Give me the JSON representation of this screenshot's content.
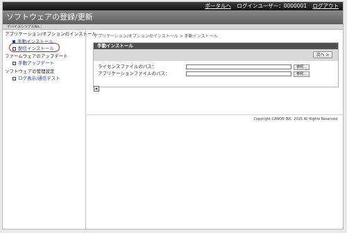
{
  "topbar": {
    "portal_link": "ポータルへ",
    "login_user_label": "ログインユーザー：",
    "login_user_id": "0000001",
    "logout_link": "ログアウト"
  },
  "header": {
    "title": "ソフトウェアの登録/更新"
  },
  "subheader": {
    "device_serial": "デバイスシリアルNo.："
  },
  "sidebar": {
    "sections": [
      {
        "label": "アプリケーション/オプションのインストール",
        "items": [
          {
            "label": "手動インストール",
            "selected": true
          },
          {
            "label": "配信インストール",
            "selected": false
          }
        ]
      },
      {
        "label": "ファームウェアのアップデート",
        "items": [
          {
            "label": "手動アップデート",
            "selected": false
          }
        ]
      },
      {
        "label": "ソフトウェアの管理設定",
        "items": [
          {
            "label": "ログ表示/通信テスト",
            "selected": false
          }
        ]
      }
    ]
  },
  "breadcrumb": "アプリケーション/オプションのインストール > 手動インストール",
  "panel": {
    "title": "手動インストール",
    "next_button": "次へ >",
    "license_label": "ライセンスファイルのパス：",
    "license_value": "",
    "application_label": "アプリケーションファイルのパス：",
    "application_value": "",
    "browse_button": "参照..."
  },
  "footer": {
    "copyright": "Copyright CANON INC. 2015  All Rights Reserved"
  },
  "colors": {
    "link": "#2a3a9a",
    "highlight_ring": "#e01818",
    "panel_title_bg": "#505050"
  }
}
